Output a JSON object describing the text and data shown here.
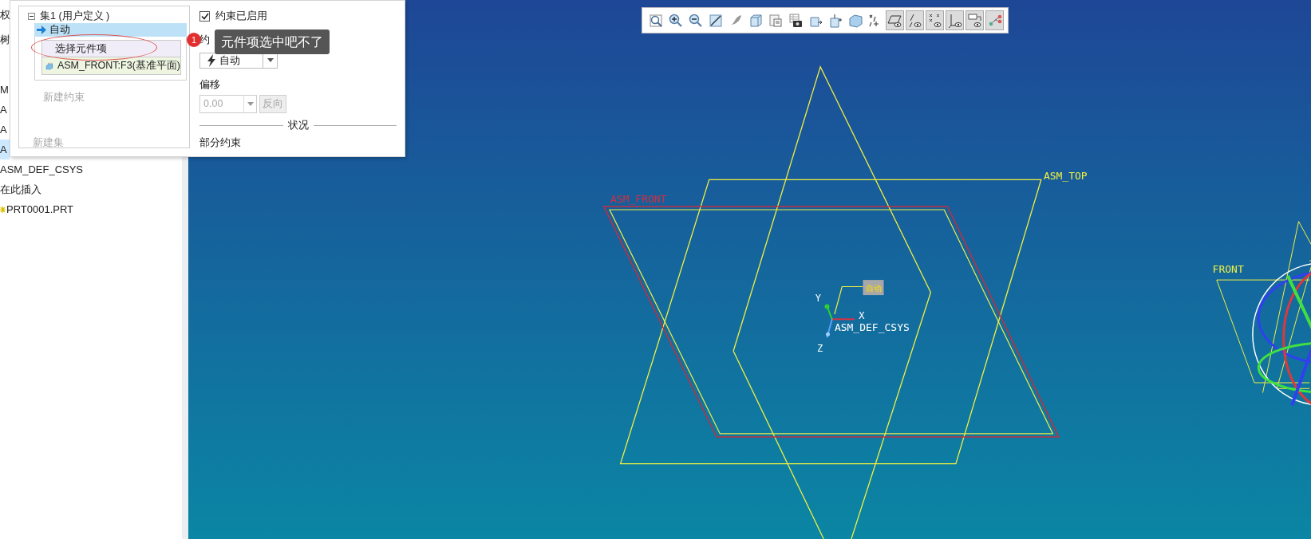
{
  "model_tree": {
    "items": [
      {
        "label": "权",
        "selected": false,
        "kind": "text"
      },
      {
        "label": "树",
        "selected": false,
        "kind": "text"
      },
      {
        "label": "M",
        "selected": false,
        "kind": "text"
      },
      {
        "label": "A",
        "selected": false,
        "kind": "text"
      },
      {
        "label": "A",
        "selected": false,
        "kind": "text"
      },
      {
        "label": "A",
        "selected": true,
        "kind": "text"
      },
      {
        "label": "ASM_DEF_CSYS",
        "selected": false,
        "kind": "text"
      },
      {
        "label": "在此插入",
        "selected": false,
        "kind": "text"
      },
      {
        "label": "PRT0001.PRT",
        "selected": false,
        "kind": "part"
      }
    ]
  },
  "constraint_panel": {
    "set": {
      "label": "集1 (用户定义 )",
      "expanded": true
    },
    "constraint": {
      "label": "自动",
      "selected": true
    },
    "references": [
      {
        "label": "选择元件项",
        "kind": "prompt"
      },
      {
        "label": "ASM_FRONT:F3(基准平面)",
        "kind": "datum"
      }
    ],
    "new_constraint": "新建约束",
    "new_set": "新建集",
    "enabled": {
      "label": "约束已启用",
      "checked": true
    },
    "type_label": "约",
    "type_value": "自动",
    "offset_label": "偏移",
    "offset": {
      "value": "0.00",
      "disabled": true
    },
    "flip": {
      "label": "反向",
      "disabled": true
    },
    "status_title": "状况",
    "status": "部分约束"
  },
  "annotation": {
    "number": "1",
    "note": "元件项选中吧不了"
  },
  "toolbar": {
    "buttons": [
      {
        "kind": "refit",
        "pressed": false
      },
      {
        "kind": "zoomin",
        "pressed": false
      },
      {
        "kind": "zoomout",
        "pressed": false
      },
      {
        "kind": "repaint",
        "pressed": false
      },
      {
        "kind": "shading",
        "pressed": false
      },
      {
        "kind": "cube",
        "pressed": false
      },
      {
        "kind": "views",
        "pressed": false
      },
      {
        "kind": "camera",
        "pressed": false
      },
      {
        "kind": "cubeleft",
        "pressed": false
      },
      {
        "kind": "cubeup",
        "pressed": false
      },
      {
        "kind": "glass",
        "pressed": false
      },
      {
        "kind": "datumdisplay",
        "pressed": false
      },
      {
        "kind": "planes",
        "pressed": true
      },
      {
        "kind": "axes",
        "pressed": true
      },
      {
        "kind": "points",
        "pressed": true
      },
      {
        "kind": "csys",
        "pressed": true
      },
      {
        "kind": "tags",
        "pressed": true
      },
      {
        "kind": "nodes",
        "pressed": true
      }
    ]
  },
  "viewport": {
    "labels": [
      {
        "text": "ASM_TOP",
        "kind": "datum"
      },
      {
        "text": "ASM_FRONT",
        "kind": "highlight"
      },
      {
        "text": "FRONT",
        "kind": "datum"
      },
      {
        "text": "自动",
        "kind": "tag"
      },
      {
        "text": "Y",
        "kind": "axis"
      },
      {
        "text": "X",
        "kind": "axis"
      },
      {
        "text": "ASM_DEF_CSYS",
        "kind": "csys"
      },
      {
        "text": "Z",
        "kind": "axis"
      }
    ]
  }
}
